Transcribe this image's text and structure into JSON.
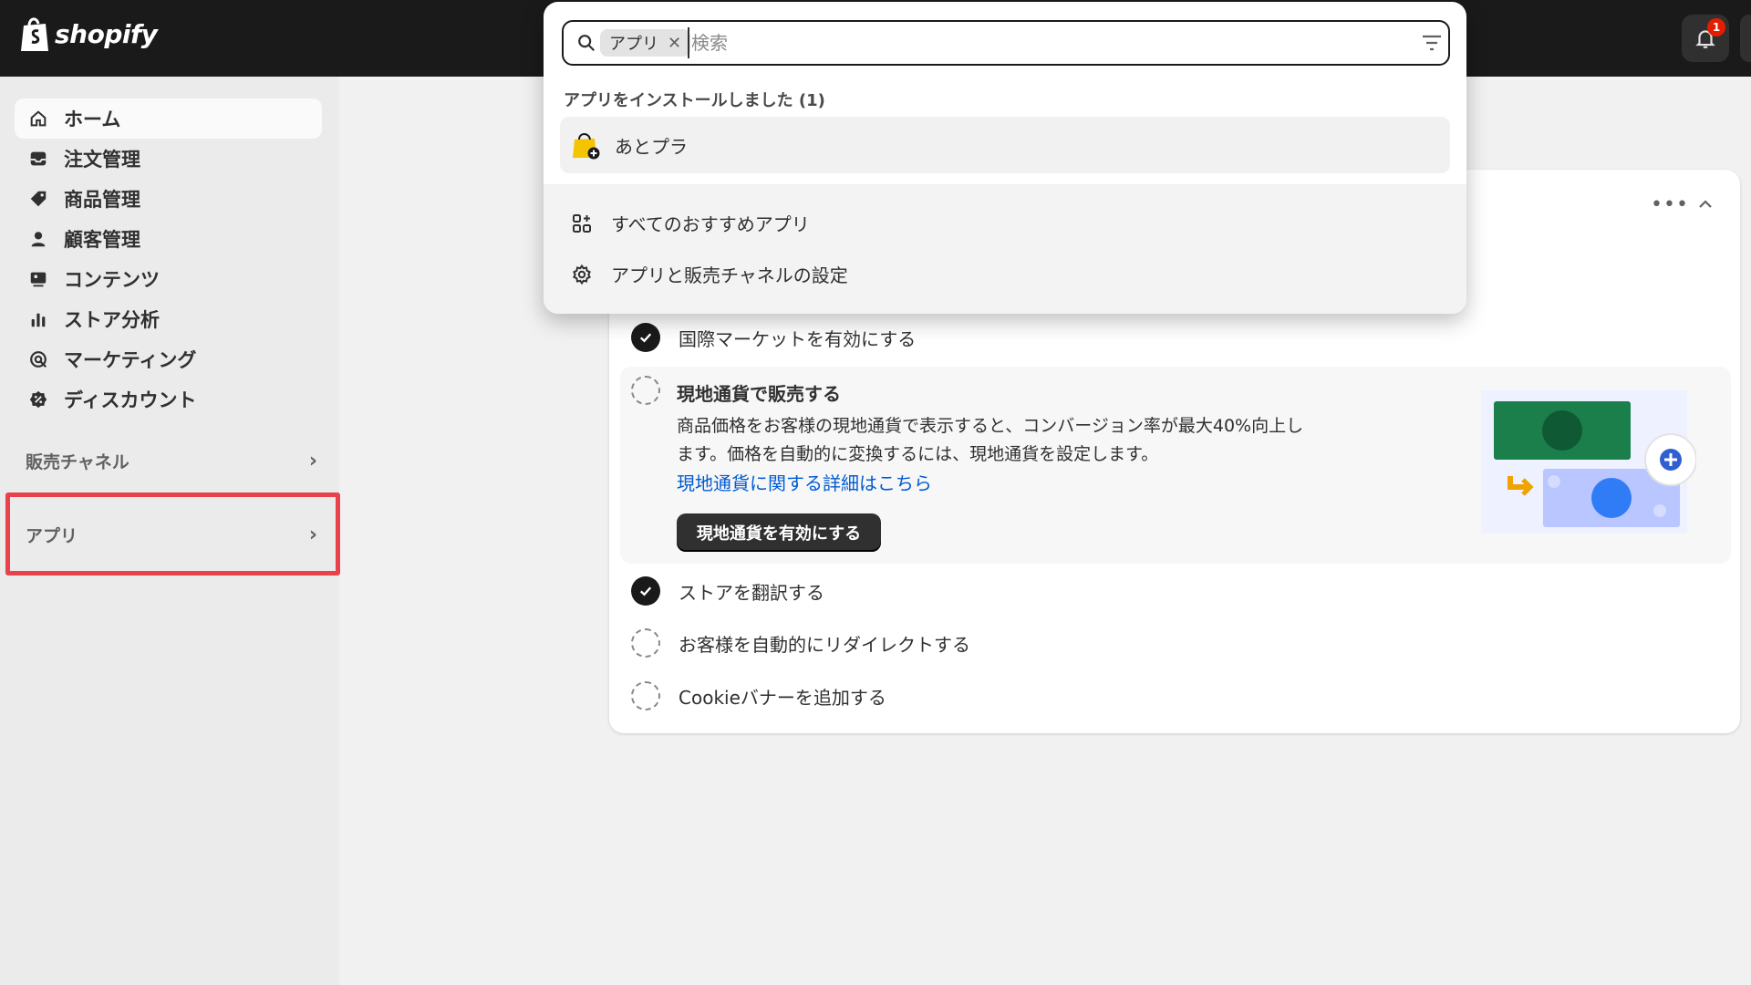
{
  "brand": {
    "name": "shopify",
    "icon": "shopify-bag-icon"
  },
  "topbar": {
    "notification_icon": "bell-icon",
    "notification_count": "1"
  },
  "sidebar": {
    "items": [
      {
        "label": "ホーム",
        "icon": "home-icon",
        "active": true
      },
      {
        "label": "注文管理",
        "icon": "inbox-icon"
      },
      {
        "label": "商品管理",
        "icon": "tag-icon"
      },
      {
        "label": "顧客管理",
        "icon": "person-icon"
      },
      {
        "label": "コンテンツ",
        "icon": "content-icon"
      },
      {
        "label": "ストア分析",
        "icon": "bar-chart-icon"
      },
      {
        "label": "マーケティング",
        "icon": "target-icon"
      },
      {
        "label": "ディスカウント",
        "icon": "discount-icon"
      }
    ],
    "sales_channels": {
      "label": "販売チャネル"
    },
    "apps": {
      "label": "アプリ"
    }
  },
  "search": {
    "chip_label": "アプリ",
    "placeholder": "検索",
    "installed_title": "アプリをインストールしました (1)",
    "installed_apps": [
      {
        "name": "あとプラ"
      }
    ],
    "links": [
      {
        "label": "すべてのおすすめアプリ",
        "icon": "apps-grid-icon"
      },
      {
        "label": "アプリと販売チャネルの設定",
        "icon": "gear-icon"
      }
    ]
  },
  "card": {
    "more_label": "•••",
    "tasks": [
      {
        "label": "国際マーケットを有効にする",
        "done": true
      },
      {
        "label": "現地通貨で販売する",
        "done": false,
        "expanded": true
      },
      {
        "label": "ストアを翻訳する",
        "done": true
      },
      {
        "label": "お客様を自動的にリダイレクトする",
        "done": false
      },
      {
        "label": "Cookieバナーを追加する",
        "done": false
      }
    ],
    "active": {
      "title": "現地通貨で販売する",
      "description_line1": "商品価格をお客様の現地通貨で表示すると、コンバージョン率が最大40%向上し",
      "description_line2": "ます。価格を自動的に変換するには、現地通貨を設定します。",
      "link": "現地通貨に関する詳細はこちら",
      "button": "現地通貨を有効にする"
    }
  },
  "colors": {
    "topbar": "#1a1a1a",
    "link": "#005bd3",
    "highlight": "#e8434a",
    "illus_green": "#1b7f4b",
    "illus_blue": "#2f7cf6"
  }
}
